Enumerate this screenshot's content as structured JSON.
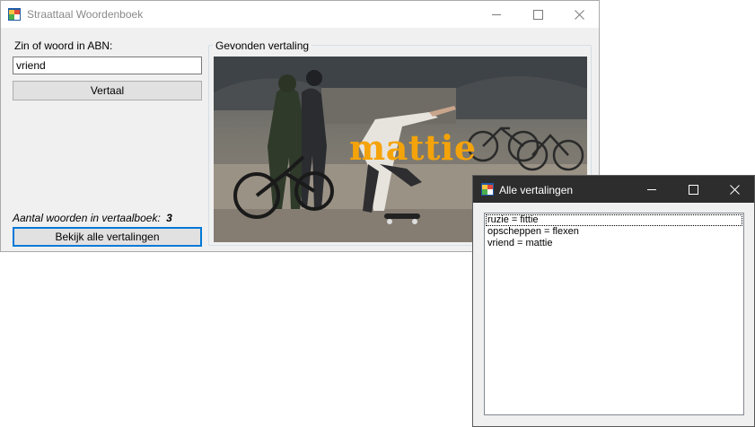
{
  "main_window": {
    "title": "Straattaal Woordenboek",
    "input_label": "Zin of woord in ABN:",
    "input_value": "vriend",
    "translate_button": "Vertaal",
    "count_label": "Aantal woorden in vertaalboek:",
    "count_value": "3",
    "view_all_button": "Bekijk alle vertalingen",
    "group_caption": "Gevonden vertaling",
    "translation_word": "mattie"
  },
  "list_window": {
    "title": "Alle vertalingen",
    "items": [
      "ruzie = fittie",
      "opscheppen = flexen",
      "vriend = mattie"
    ]
  },
  "colors": {
    "overlay_text": "#f5a30a",
    "focus_border": "#0078d7",
    "dark_titlebar": "#2d2d2d"
  },
  "icons": [
    "app-icon",
    "minimize-icon",
    "maximize-icon",
    "close-icon"
  ]
}
